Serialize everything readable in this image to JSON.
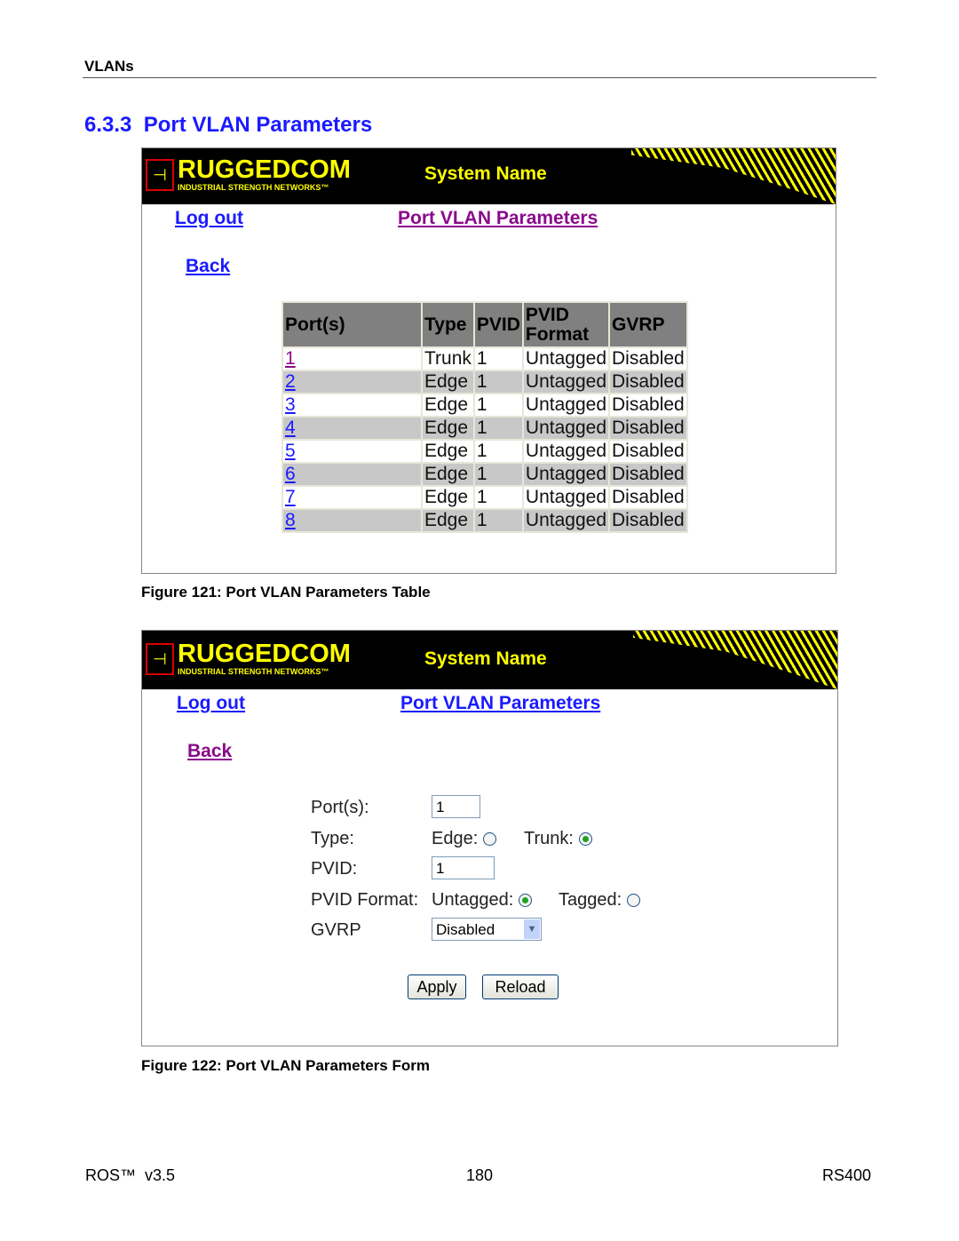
{
  "header": {
    "chapter": "VLANs"
  },
  "section": {
    "number": "6.3.3",
    "title": "Port VLAN Parameters"
  },
  "app": {
    "brand": "RUGGEDCOM",
    "tagline": "INDUSTRIAL STRENGTH NETWORKS™",
    "system_name": "System Name",
    "logout": "Log out",
    "page_title": "Port VLAN Parameters",
    "back": "Back",
    "colors": {
      "banner": "#000000",
      "brand": "#ffff00",
      "link": "#1a1aff",
      "visited": "#8a0a8a"
    }
  },
  "table": {
    "columns": [
      "Port(s)",
      "Type",
      "PVID",
      "PVID Format",
      "GVRP"
    ],
    "rows": [
      {
        "port": "1",
        "type": "Trunk",
        "pvid": "1",
        "format": "Untagged",
        "gvrp": "Disabled"
      },
      {
        "port": "2",
        "type": "Edge",
        "pvid": "1",
        "format": "Untagged",
        "gvrp": "Disabled"
      },
      {
        "port": "3",
        "type": "Edge",
        "pvid": "1",
        "format": "Untagged",
        "gvrp": "Disabled"
      },
      {
        "port": "4",
        "type": "Edge",
        "pvid": "1",
        "format": "Untagged",
        "gvrp": "Disabled"
      },
      {
        "port": "5",
        "type": "Edge",
        "pvid": "1",
        "format": "Untagged",
        "gvrp": "Disabled"
      },
      {
        "port": "6",
        "type": "Edge",
        "pvid": "1",
        "format": "Untagged",
        "gvrp": "Disabled"
      },
      {
        "port": "7",
        "type": "Edge",
        "pvid": "1",
        "format": "Untagged",
        "gvrp": "Disabled"
      },
      {
        "port": "8",
        "type": "Edge",
        "pvid": "1",
        "format": "Untagged",
        "gvrp": "Disabled"
      }
    ]
  },
  "fig1_caption": "Figure 121: Port VLAN Parameters Table",
  "form": {
    "ports_label": "Port(s):",
    "ports_value": "1",
    "type_label": "Type:",
    "edge_label": "Edge:",
    "trunk_label": "Trunk:",
    "type_selected": "Trunk",
    "pvid_label": "PVID:",
    "pvid_value": "1",
    "format_label": "PVID Format:",
    "untagged_label": "Untagged:",
    "tagged_label": "Tagged:",
    "format_selected": "Untagged",
    "gvrp_label": "GVRP",
    "gvrp_value": "Disabled",
    "apply": "Apply",
    "reload": "Reload"
  },
  "fig2_caption": "Figure 122: Port VLAN Parameters Form",
  "footer": {
    "left": "ROS™  v3.5",
    "center": "180",
    "right": "RS400"
  }
}
